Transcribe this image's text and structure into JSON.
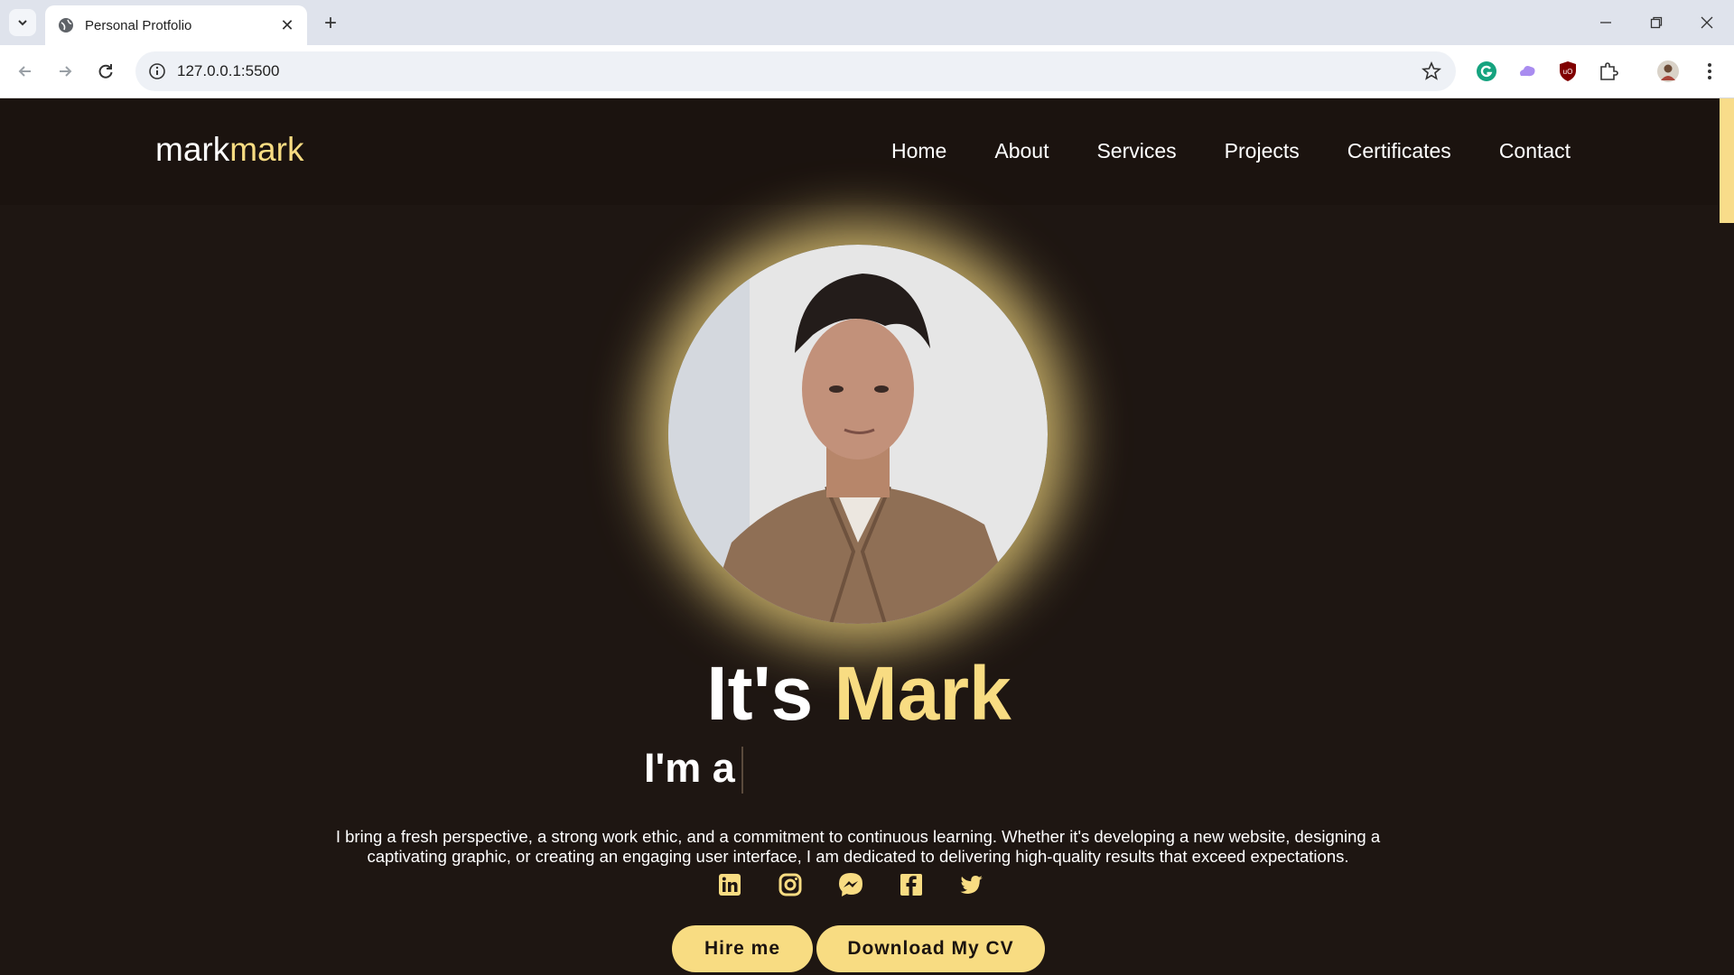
{
  "browser": {
    "tab_title": "Personal Protfolio",
    "url": "127.0.0.1:5500"
  },
  "colors": {
    "accent": "#f8dc82",
    "background": "#1e1612",
    "header_bg": "#1b130f"
  },
  "header": {
    "logo_part1": "mark",
    "logo_part2": "mark",
    "nav": [
      "Home",
      "About",
      "Services",
      "Projects",
      "Certificates",
      "Contact"
    ]
  },
  "hero": {
    "headline_part1": "It's",
    "headline_part2": "Mark",
    "subline": "I'm a",
    "description_line1": "I bring a fresh perspective, a strong work ethic, and a commitment to continuous learning. Whether it's developing a new website, designing a",
    "description_line2": "captivating graphic, or creating an engaging user interface, I am dedicated to delivering high-quality results that exceed expectations.",
    "socials": [
      "linkedin-icon",
      "instagram-icon",
      "messenger-icon",
      "facebook-icon",
      "twitter-icon"
    ],
    "buttons": {
      "hire": "Hire me",
      "cv": "Download My CV"
    }
  }
}
